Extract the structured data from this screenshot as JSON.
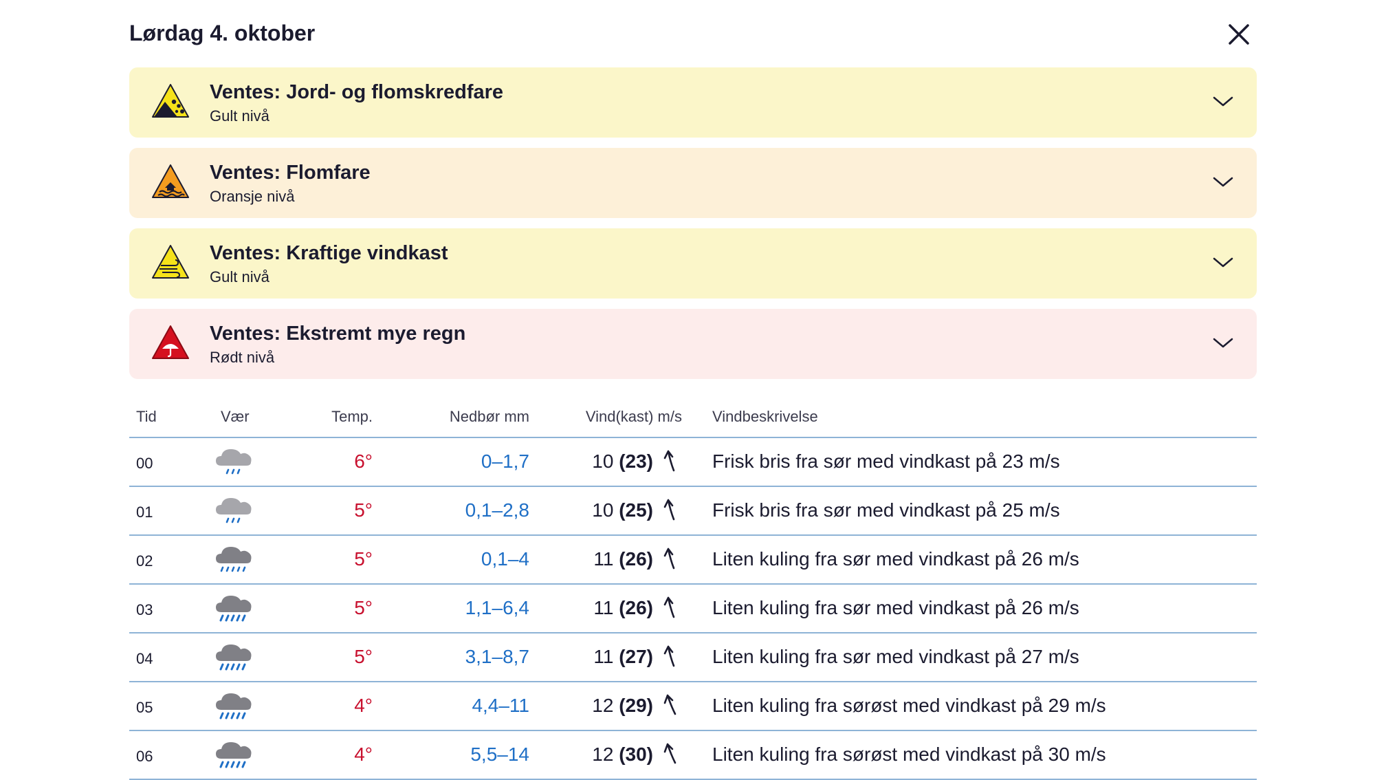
{
  "header": {
    "title": "Lørdag 4. oktober"
  },
  "warnings": [
    {
      "title": "Ventes: Jord- og flomskredfare",
      "level": "Gult nivå",
      "icon": "landslide-warning-icon",
      "bg": "#fbf6c9"
    },
    {
      "title": "Ventes: Flomfare",
      "level": "Oransje nivå",
      "icon": "flood-warning-icon",
      "bg": "#fdf0d8"
    },
    {
      "title": "Ventes: Kraftige vindkast",
      "level": "Gult nivå",
      "icon": "wind-warning-icon",
      "bg": "#fbf6c9"
    },
    {
      "title": "Ventes: Ekstremt mye regn",
      "level": "Rødt nivå",
      "icon": "rain-warning-icon",
      "bg": "#fdeceb"
    }
  ],
  "table": {
    "headers": {
      "time": "Tid",
      "weather": "Vær",
      "temp": "Temp.",
      "precip": "Nedbør mm",
      "wind": "Vind(kast) m/s",
      "desc": "Vindbeskrivelse"
    },
    "rows": [
      {
        "time": "00",
        "icon": "light-rain-icon",
        "temp": "6°",
        "precip": "0–1,7",
        "wind": "10",
        "gust": "(23)",
        "desc": "Frisk bris fra sør med vindkast på 23 m/s"
      },
      {
        "time": "01",
        "icon": "light-rain-icon",
        "temp": "5°",
        "precip": "0,1–2,8",
        "wind": "10",
        "gust": "(25)",
        "desc": "Frisk bris fra sør med vindkast på 25 m/s"
      },
      {
        "time": "02",
        "icon": "rain-icon",
        "temp": "5°",
        "precip": "0,1–4",
        "wind": "11",
        "gust": "(26)",
        "desc": "Liten kuling fra sør med vindkast på 26 m/s"
      },
      {
        "time": "03",
        "icon": "heavy-rain-icon",
        "temp": "5°",
        "precip": "1,1–6,4",
        "wind": "11",
        "gust": "(26)",
        "desc": "Liten kuling fra sør med vindkast på 26 m/s"
      },
      {
        "time": "04",
        "icon": "heavy-rain-icon",
        "temp": "5°",
        "precip": "3,1–8,7",
        "wind": "11",
        "gust": "(27)",
        "desc": "Liten kuling fra sør med vindkast på 27 m/s"
      },
      {
        "time": "05",
        "icon": "heavy-rain-icon",
        "temp": "4°",
        "precip": "4,4–11",
        "wind": "12",
        "gust": "(29)",
        "desc": "Liten kuling fra sørøst med vindkast på 29 m/s"
      },
      {
        "time": "06",
        "icon": "heavy-rain-icon",
        "temp": "4°",
        "precip": "5,5–14",
        "wind": "12",
        "gust": "(30)",
        "desc": "Liten kuling fra sørøst med vindkast på 30 m/s"
      }
    ]
  },
  "colors": {
    "temp_warm": "#c8102e",
    "precip": "#1f6fc6",
    "divider": "#8eb3d6",
    "warn_yellow": "#f5e21a",
    "warn_orange": "#f39c1f",
    "warn_red": "#d5101f"
  }
}
